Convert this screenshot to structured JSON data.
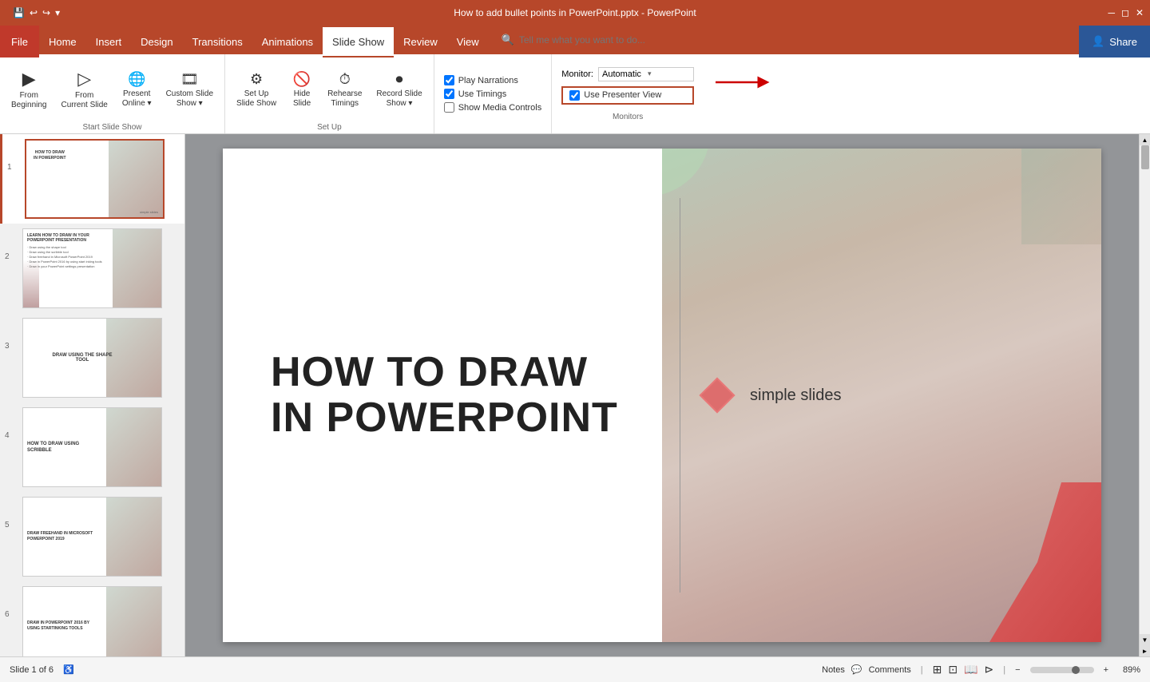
{
  "titlebar": {
    "title": "How to add bullet points in PowerPoint.pptx - PowerPoint",
    "save_label": "💾",
    "undo_label": "↩",
    "redo_label": "↪",
    "customize_label": "▾"
  },
  "menubar": {
    "file": "File",
    "items": [
      "Home",
      "Insert",
      "Design",
      "Transitions",
      "Animations",
      "Slide Show",
      "Review",
      "View"
    ]
  },
  "ribbon": {
    "active_tab": "Slide Show",
    "tell_me": "Tell me what you want to do...",
    "share_label": "Share",
    "groups": {
      "start_slideshow": {
        "label": "Start Slide Show",
        "buttons": [
          {
            "id": "from-beginning",
            "label": "From\nBeginning",
            "icon": "▶"
          },
          {
            "id": "from-current",
            "label": "From\nCurrent Slide",
            "icon": "▷"
          },
          {
            "id": "present-online",
            "label": "Present\nOnline▾",
            "icon": "📡"
          },
          {
            "id": "custom-show",
            "label": "Custom Slide\nShow▾",
            "icon": "🎞"
          }
        ]
      },
      "setup": {
        "label": "Set Up",
        "buttons": [
          {
            "id": "setup-slideshow",
            "label": "Set Up\nSlide Show",
            "icon": "⚙"
          },
          {
            "id": "hide-slide",
            "label": "Hide\nSlide",
            "icon": "🚫"
          },
          {
            "id": "rehearse",
            "label": "Rehearse\nTimings",
            "icon": "⏱"
          },
          {
            "id": "record",
            "label": "Record Slide\nShow▾",
            "icon": "⏺"
          }
        ]
      },
      "checkboxes": {
        "play_narrations": {
          "label": "Play Narrations",
          "checked": true
        },
        "use_timings": {
          "label": "Use Timings",
          "checked": true
        },
        "show_media_controls": {
          "label": "Show Media Controls",
          "checked": false
        }
      },
      "monitors": {
        "label": "Monitors",
        "monitor_label": "Monitor:",
        "monitor_value": "Automatic",
        "presenter_view_label": "Use Presenter View",
        "presenter_view_checked": true
      }
    }
  },
  "slides": [
    {
      "num": 1,
      "title": "HOW TO DRAW\nIN POWERPOINT",
      "active": true,
      "subtitle": ""
    },
    {
      "num": 2,
      "title": "LEARN HOW TO DRAW IN YOUR\nPOWERPOINT PRESENTATION",
      "active": false
    },
    {
      "num": 3,
      "title": "DRAW USING THE SHAPE TOOL",
      "active": false
    },
    {
      "num": 4,
      "title": "HOW TO DRAW USING\nSCRIBBLE",
      "active": false
    },
    {
      "num": 5,
      "title": "DRAW FREEHAND IN MICROSOFT\nPOWERPOINT 2019",
      "active": false
    },
    {
      "num": 6,
      "title": "DRAW IN POWERPOINT 2016 BY\nUSING STARTINKING TOOLS",
      "active": false
    }
  ],
  "main_slide": {
    "title_line1": "HOW TO DRAW",
    "title_line2": "IN POWERPOINT",
    "logo_name": "simple slides"
  },
  "statusbar": {
    "slide_info": "Slide 1 of 6",
    "notes_label": "Notes",
    "comments_label": "Comments",
    "zoom": "89%"
  }
}
